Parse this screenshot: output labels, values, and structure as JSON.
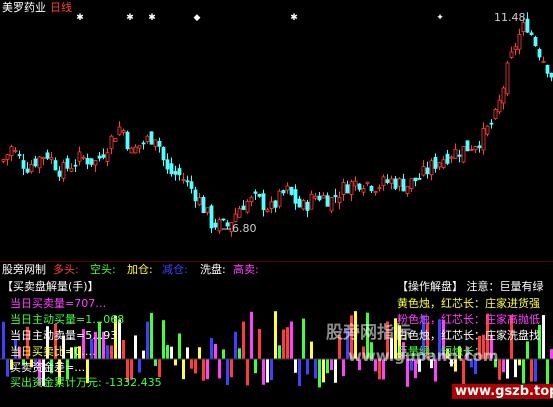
{
  "main_header": {
    "stock_name": "美罗药业",
    "period": "日线"
  },
  "price_panel": {
    "high_label": "11.48",
    "low_label": "6.80",
    "markers": [
      "✱",
      "✱",
      "✱",
      "◆",
      "✱",
      "✦"
    ],
    "colors": {
      "up": "#ff3c3c",
      "down": "#54ffff",
      "label": "#cccccc"
    }
  },
  "indicator_header": {
    "name": "股旁网制",
    "items": [
      {
        "label": "多头:",
        "color": "#ff4040"
      },
      {
        "label": "空头:",
        "color": "#40ff40"
      },
      {
        "label": "加仓:",
        "color": "#ffff40"
      },
      {
        "label": "减仓:",
        "color": "#4040ff"
      },
      {
        "label": "洗盘:",
        "color": "#ffffff"
      },
      {
        "label": "高卖:",
        "color": "#ff40ff"
      }
    ]
  },
  "info_left": {
    "title": "【买卖盘解量(手)】",
    "lines": [
      {
        "text": "当日买卖量=707…",
        "color": "#ff40ff"
      },
      {
        "text": "当日主动买量=1…068",
        "color": "#40ff40"
      },
      {
        "text": "当日主动卖量=5…93",
        "color": "#ffffff"
      },
      {
        "text": "当日买卖比=0.…",
        "color": "#ffff40"
      },
      {
        "text": "买卖资金差=…",
        "color": "#ffffff"
      },
      {
        "text": "买出资金累计万元: -1332.435",
        "color": "#40ff40"
      }
    ]
  },
  "info_right": {
    "title": "【操作解盘】 注意：巨量有绿",
    "lines": [
      {
        "text": "黄色烛，红芯长：庄家进货强",
        "color": "#ffff40"
      },
      {
        "text": "粉色烛，红芯长：庄家高抛低",
        "color": "#ff40ff"
      },
      {
        "text": "白色烛，红芯长：庄家洗盘找",
        "color": "#ffffff"
      },
      {
        "text": "巨量绿，短烛长：…",
        "color": "#40ff40"
      }
    ]
  },
  "watermark": {
    "cn_text": "股旁网指标",
    "url": "www.gupang.com"
  },
  "corner_stamp": {
    "url": "www.gszb.top"
  },
  "chart_data": {
    "type": "candlestick",
    "high_label": 11.48,
    "low_label": 6.8,
    "price_range": [
      6.8,
      11.48
    ],
    "volume_bar_colors": [
      "#ff3c3c",
      "#40ff40",
      "#ffff40",
      "#ffffff",
      "#ff40ff",
      "#4040ff"
    ]
  }
}
